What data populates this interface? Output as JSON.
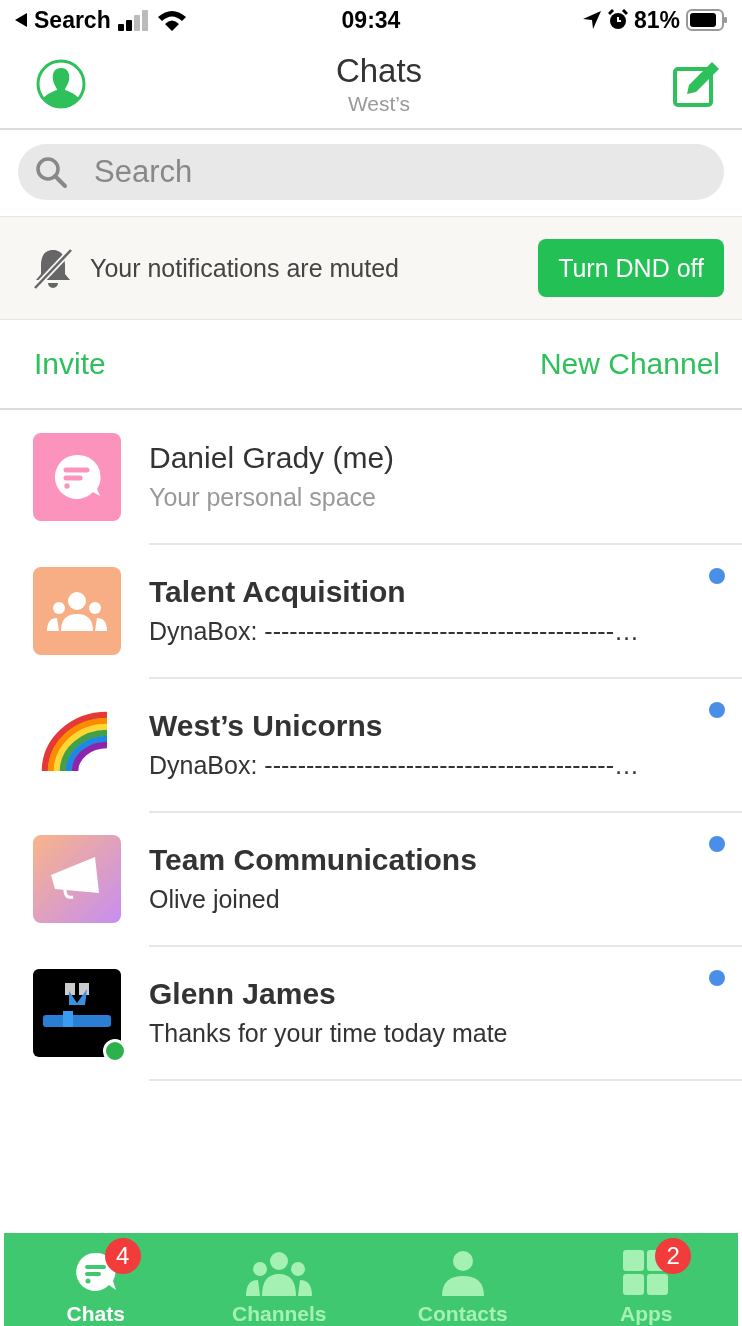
{
  "status_bar": {
    "back_label": "Search",
    "time": "09:34",
    "battery": "81%"
  },
  "header": {
    "title": "Chats",
    "subtitle": "West’s"
  },
  "search": {
    "placeholder": "Search"
  },
  "mute_banner": {
    "text": "Your notifications are muted",
    "button": "Turn DND off"
  },
  "actions": {
    "left": "Invite",
    "right": "New Channel"
  },
  "chats": [
    {
      "kind": "personal",
      "name": "Daniel Grady (me)",
      "preview": "Your personal space",
      "unread": false,
      "online": false
    },
    {
      "kind": "group",
      "name": "Talent Acquisition",
      "preview": "DynaBox: ------------------------------------------…",
      "unread": true,
      "online": false
    },
    {
      "kind": "rainbow",
      "name": "West’s Unicorns",
      "preview": "DynaBox: ------------------------------------------…",
      "unread": true,
      "online": false
    },
    {
      "kind": "megaphone",
      "name": "Team Communications",
      "preview": "Olive joined",
      "unread": true,
      "online": false
    },
    {
      "kind": "picture",
      "name": "Glenn James",
      "preview": "Thanks for your time today mate",
      "unread": true,
      "online": true
    }
  ],
  "tabs": [
    {
      "kind": "chats",
      "label": "Chats",
      "selected": true,
      "badge": "4"
    },
    {
      "kind": "channels",
      "label": "Channels",
      "selected": false
    },
    {
      "kind": "contacts",
      "label": "Contacts",
      "selected": false
    },
    {
      "kind": "apps",
      "label": "Apps",
      "selected": false,
      "badge": "2"
    }
  ]
}
